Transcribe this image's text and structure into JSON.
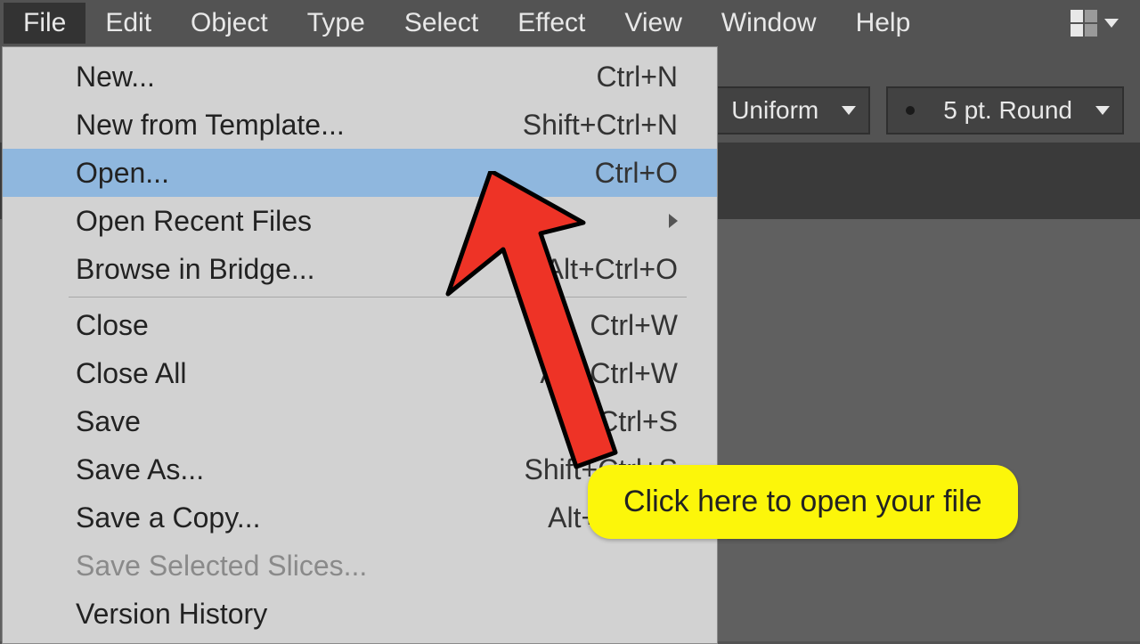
{
  "menubar": {
    "items": [
      {
        "label": "File",
        "active": true
      },
      {
        "label": "Edit"
      },
      {
        "label": "Object"
      },
      {
        "label": "Type"
      },
      {
        "label": "Select"
      },
      {
        "label": "Effect"
      },
      {
        "label": "View"
      },
      {
        "label": "Window"
      },
      {
        "label": "Help"
      }
    ]
  },
  "controlbar": {
    "stroke_profile": "Uniform",
    "brush": "5 pt. Round"
  },
  "file_menu": {
    "groups": [
      [
        {
          "label": "New...",
          "shortcut": "Ctrl+N"
        },
        {
          "label": "New from Template...",
          "shortcut": "Shift+Ctrl+N"
        },
        {
          "label": "Open...",
          "shortcut": "Ctrl+O",
          "highlight": true
        },
        {
          "label": "Open Recent Files",
          "submenu": true
        },
        {
          "label": "Browse in Bridge...",
          "shortcut": "Alt+Ctrl+O"
        }
      ],
      [
        {
          "label": "Close",
          "shortcut": "Ctrl+W"
        },
        {
          "label": "Close All",
          "shortcut": "Alt+Ctrl+W"
        },
        {
          "label": "Save",
          "shortcut": "Ctrl+S"
        },
        {
          "label": "Save As...",
          "shortcut": "Shift+Ctrl+S"
        },
        {
          "label": "Save a Copy...",
          "shortcut": "Alt+Ctrl+S"
        },
        {
          "label": "Save Selected Slices...",
          "disabled": true
        },
        {
          "label": "Version History"
        }
      ]
    ]
  },
  "callout": "Click here to open your file"
}
